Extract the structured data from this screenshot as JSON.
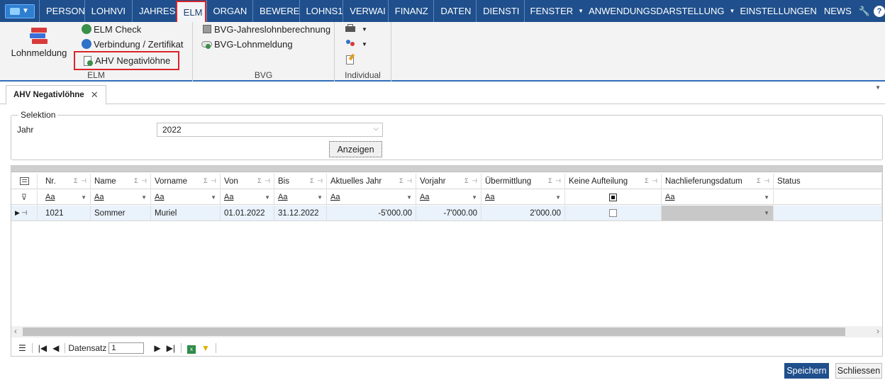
{
  "menubar": {
    "app_button_label": "▼",
    "tabs": [
      "PERSON",
      "LOHNVI",
      "JAHRESI",
      "ELM",
      "ORGAN",
      "BEWERE",
      "LOHNS1",
      "VERWAI",
      "FINANZ",
      "DATEN",
      "DIENSTI"
    ],
    "right": [
      "FENSTER",
      "ANWENDUNGSDARSTELLUNG",
      "EINSTELLUNGEN",
      "NEWS"
    ]
  },
  "ribbon": {
    "lohnmeldung_label": "Lohnmeldung",
    "elm_check_label": "ELM Check",
    "verbindung_label": "Verbindung / Zertifikat",
    "ahv_label": "AHV Negativlöhne",
    "elm_group_label": "ELM",
    "bvg_jahres_label": "BVG-Jahreslohnberechnung",
    "bvg_lohnmeldung_label": "BVG-Lohnmeldung",
    "bvg_group_label": "BVG",
    "individual_group_label": "Individual"
  },
  "doc_tab": {
    "label": "AHV Negativlöhne",
    "close": "✕"
  },
  "selektion": {
    "legend": "Selektion",
    "jahr_label": "Jahr",
    "jahr_value": "2022",
    "anzeigen_label": "Anzeigen"
  },
  "grid": {
    "columns": [
      "Nr.",
      "Name",
      "Vorname",
      "Von",
      "Bis",
      "Aktuelles Jahr",
      "Vorjahr",
      "Übermittlung",
      "Keine Aufteilung",
      "Nachlieferungsdatum",
      "Status"
    ],
    "filter_token": "Aa",
    "row": {
      "nr": "1021",
      "name": "Sommer",
      "vorname": "Muriel",
      "von": "01.01.2022",
      "bis": "31.12.2022",
      "aktuelles_jahr": "-5'000.00",
      "vorjahr": "-7'000.00",
      "uebermittlung": "2'000.00",
      "keine_aufteilung": false,
      "nachlieferungsdatum": "",
      "status": ""
    },
    "navigator": {
      "datensatz_label": "Datensatz",
      "position": "1"
    }
  },
  "footer": {
    "save_label": "Speichern",
    "close_label": "Schliessen"
  },
  "colors": {
    "menubar": "#1f4f8c",
    "highlight": "#d9252a",
    "primary_button": "#1f4f8c"
  }
}
